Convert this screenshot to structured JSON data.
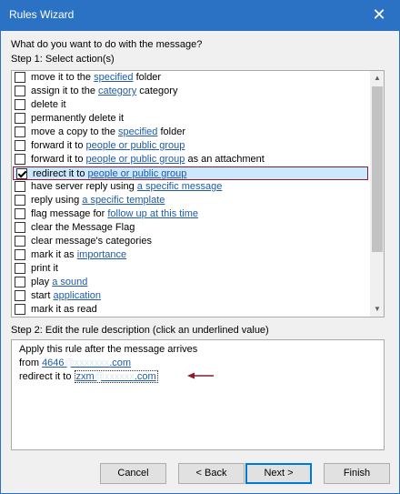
{
  "window": {
    "title": "Rules Wizard",
    "close_glyph": "✕"
  },
  "question": "What do you want to do with the message?",
  "step1_label": "Step 1: Select action(s)",
  "actions": [
    {
      "parts": [
        {
          "t": "move it to the "
        },
        {
          "t": "specified",
          "link": true
        },
        {
          "t": " folder"
        }
      ],
      "checked": false
    },
    {
      "parts": [
        {
          "t": "assign it to the "
        },
        {
          "t": "category",
          "link": true
        },
        {
          "t": " category"
        }
      ],
      "checked": false
    },
    {
      "parts": [
        {
          "t": "delete it"
        }
      ],
      "checked": false
    },
    {
      "parts": [
        {
          "t": "permanently delete it"
        }
      ],
      "checked": false
    },
    {
      "parts": [
        {
          "t": "move a copy to the "
        },
        {
          "t": "specified",
          "link": true
        },
        {
          "t": " folder"
        }
      ],
      "checked": false
    },
    {
      "parts": [
        {
          "t": "forward it to "
        },
        {
          "t": "people or public group",
          "link": true
        }
      ],
      "checked": false
    },
    {
      "parts": [
        {
          "t": "forward it to "
        },
        {
          "t": "people or public group",
          "link": true
        },
        {
          "t": " as an attachment"
        }
      ],
      "checked": false
    },
    {
      "parts": [
        {
          "t": "redirect it to "
        },
        {
          "t": "people or public group",
          "link": true
        }
      ],
      "checked": true,
      "selected": true
    },
    {
      "parts": [
        {
          "t": "have server reply using "
        },
        {
          "t": "a specific message",
          "link": true
        }
      ],
      "checked": false
    },
    {
      "parts": [
        {
          "t": "reply using "
        },
        {
          "t": "a specific template",
          "link": true
        }
      ],
      "checked": false
    },
    {
      "parts": [
        {
          "t": "flag message for "
        },
        {
          "t": "follow up at this time",
          "link": true
        }
      ],
      "checked": false
    },
    {
      "parts": [
        {
          "t": "clear the Message Flag"
        }
      ],
      "checked": false
    },
    {
      "parts": [
        {
          "t": "clear message's categories"
        }
      ],
      "checked": false
    },
    {
      "parts": [
        {
          "t": "mark it as "
        },
        {
          "t": "importance",
          "link": true
        }
      ],
      "checked": false
    },
    {
      "parts": [
        {
          "t": "print it"
        }
      ],
      "checked": false
    },
    {
      "parts": [
        {
          "t": "play "
        },
        {
          "t": "a sound",
          "link": true
        }
      ],
      "checked": false
    },
    {
      "parts": [
        {
          "t": "start "
        },
        {
          "t": "application",
          "link": true
        }
      ],
      "checked": false
    },
    {
      "parts": [
        {
          "t": "mark it as read"
        }
      ],
      "checked": false
    }
  ],
  "step2_label": "Step 2: Edit the rule description (click an underlined value)",
  "description": {
    "line1": "Apply this rule after the message arrives",
    "from_prefix": "from ",
    "from_value_visible": "4646",
    "from_value_blurred": "@xxxxxxx",
    "from_value_suffix": ".com",
    "redirect_prefix": "redirect it to ",
    "redirect_value_visible": "zxm",
    "redirect_value_blurred": "@xxxxxx",
    "redirect_value_suffix": ".com",
    "annotation_color": "#8b1a2a"
  },
  "buttons": {
    "cancel": "Cancel",
    "back": "< Back",
    "next": "Next >",
    "finish": "Finish"
  },
  "colors": {
    "titlebar": "#2b72c4",
    "link": "#1e5ba8",
    "selection": "#cce8ff",
    "accent": "#0078d7"
  }
}
